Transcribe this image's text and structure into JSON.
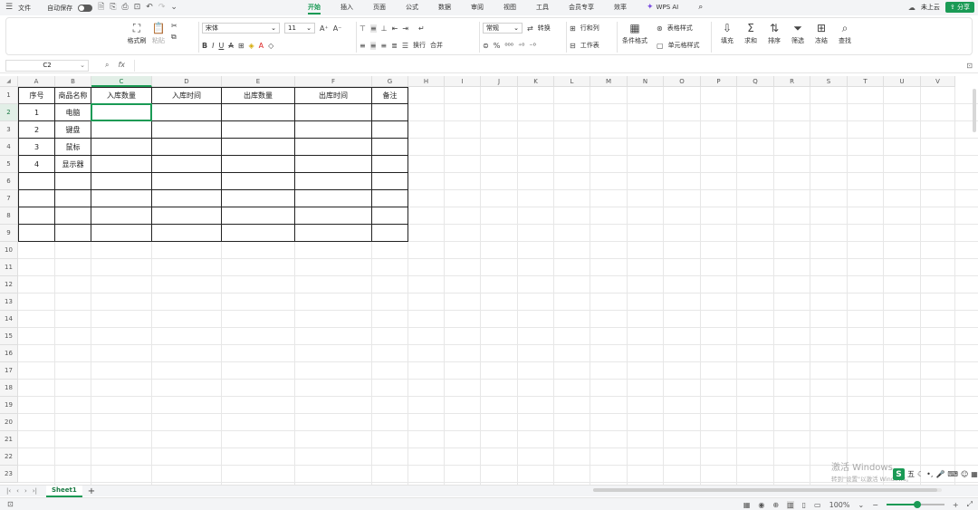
{
  "titlebar": {
    "menu_label": "文件",
    "autosave_label": "自动保存",
    "tabs": [
      {
        "label": "开始",
        "active": true
      },
      {
        "label": "插入"
      },
      {
        "label": "页面"
      },
      {
        "label": "公式"
      },
      {
        "label": "数据"
      },
      {
        "label": "审阅"
      },
      {
        "label": "视图"
      },
      {
        "label": "工具"
      },
      {
        "label": "会员专享"
      },
      {
        "label": "效率"
      },
      {
        "label": "WPS AI"
      }
    ],
    "cloud_label": "未上云",
    "share_label": "分享"
  },
  "ribbon": {
    "format_painter": "格式刷",
    "paste": "粘贴",
    "font_name": "宋体",
    "font_size": "11",
    "number_format": "常规",
    "convert": "转换",
    "wrap": "换行",
    "merge": "合并",
    "row_col": "行和列",
    "worksheet": "工作表",
    "cond_format": "条件格式",
    "table_style": "表格样式",
    "cell_style": "单元格样式",
    "fill": "填充",
    "sum": "求和",
    "sort": "排序",
    "filter": "筛选",
    "freeze": "冻结",
    "find": "查找"
  },
  "formula_bar": {
    "name_box": "C2",
    "fx": "fx",
    "value": ""
  },
  "columns": [
    "A",
    "B",
    "C",
    "D",
    "E",
    "F",
    "G",
    "H",
    "I",
    "J",
    "K",
    "L",
    "M",
    "N",
    "O",
    "P",
    "Q",
    "R",
    "S",
    "T",
    "U",
    "V"
  ],
  "rows": [
    "1",
    "2",
    "3",
    "4",
    "5",
    "6",
    "7",
    "8",
    "9",
    "10",
    "11",
    "12",
    "13",
    "14",
    "15",
    "16",
    "17",
    "18",
    "19",
    "20",
    "21",
    "22",
    "23"
  ],
  "table": {
    "headers": [
      "序号",
      "商品名称",
      "入库数量",
      "入库时间",
      "出库数量",
      "出库时间",
      "备注"
    ],
    "data": [
      [
        "1",
        "电脑"
      ],
      [
        "2",
        "键盘"
      ],
      [
        "3",
        "鼠标"
      ],
      [
        "4",
        "显示器"
      ]
    ]
  },
  "sheet_tabs": [
    {
      "label": "Sheet1",
      "active": true
    }
  ],
  "status": {
    "zoom": "100%"
  },
  "watermark": {
    "title": "激活 Windows",
    "subtitle": "转到\"设置\"以激活 Windows。"
  },
  "ime": {
    "label": "五"
  },
  "colors": {
    "accent": "#1a9a55",
    "ai_purple": "#7b4de0"
  }
}
